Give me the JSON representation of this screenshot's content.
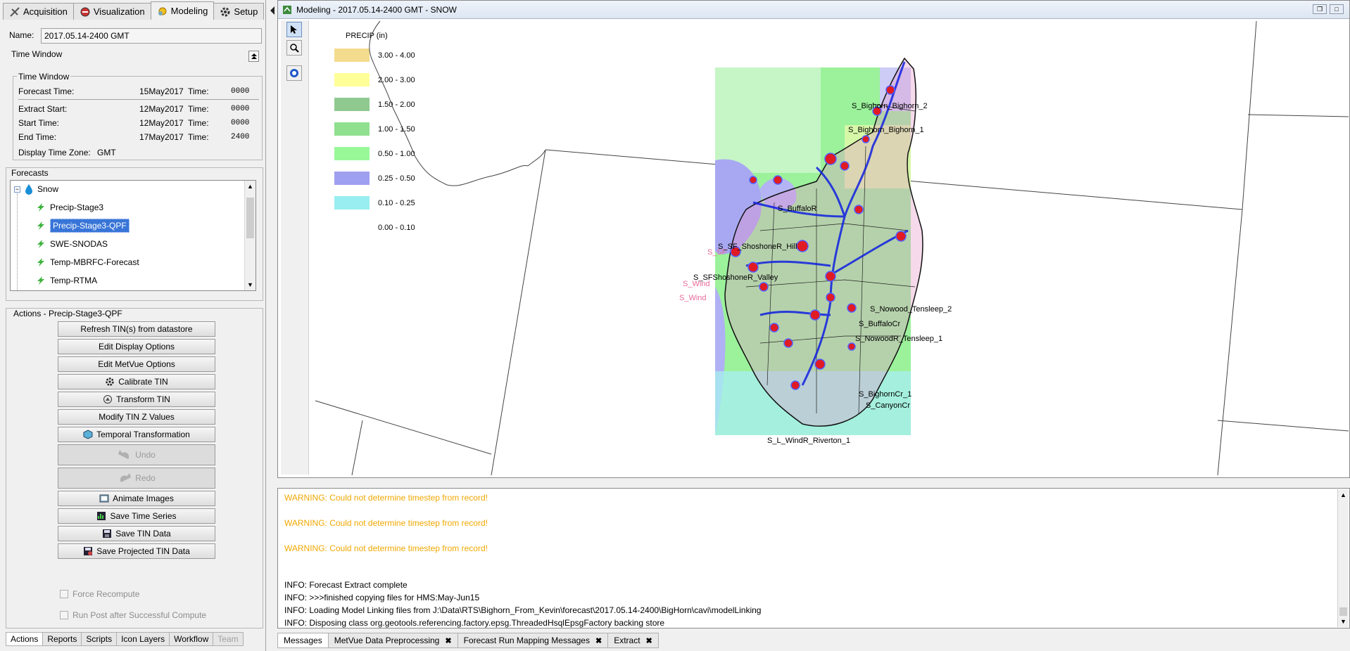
{
  "top_tabs": [
    {
      "label": "Acquisition",
      "icon": "acquisition-icon",
      "active": false
    },
    {
      "label": "Visualization",
      "icon": "visualization-icon",
      "active": false
    },
    {
      "label": "Modeling",
      "icon": "modeling-icon",
      "active": true
    },
    {
      "label": "Setup",
      "icon": "gear-icon",
      "active": false
    }
  ],
  "name": {
    "label": "Name:",
    "value": "2017.05.14-2400 GMT"
  },
  "time_window": {
    "section_label": "Time Window",
    "group_label": "Time Window",
    "forecast": {
      "label": "Forecast Time:",
      "date": "15May2017",
      "time_label": "Time:",
      "time": "0000"
    },
    "extract": {
      "label": "Extract Start:",
      "date": "12May2017",
      "time_label": "Time:",
      "time": "0000"
    },
    "start": {
      "label": "Start Time:",
      "date": "12May2017",
      "time_label": "Time:",
      "time": "0000"
    },
    "end": {
      "label": "End Time:",
      "date": "17May2017",
      "time_label": "Time:",
      "time": "2400"
    },
    "zone": {
      "label": "Display Time Zone:",
      "value": "GMT"
    }
  },
  "forecasts": {
    "label": "Forecasts",
    "root": "Snow",
    "items": [
      "Precip-Stage3",
      "Precip-Stage3-QPF",
      "SWE-SNODAS",
      "Temp-MBRFC-Forecast",
      "Temp-RTMA"
    ],
    "selected": "Precip-Stage3-QPF"
  },
  "actions": {
    "label": "Actions - Precip-Stage3-QPF",
    "buttons": [
      "Refresh TIN(s) from datastore",
      "Edit Display Options",
      "Edit MetVue Options",
      "Calibrate TIN",
      "Transform TIN",
      "Modify TIN Z Values",
      "Temporal Transformation",
      "Undo",
      "Redo",
      "Animate Images",
      "Save Time Series",
      "Save TIN Data",
      "Save Projected TIN Data"
    ],
    "checkboxes": [
      "Force Recompute",
      "Run Post after Successful Compute"
    ]
  },
  "bottom_tabs": [
    "Actions",
    "Reports",
    "Scripts",
    "Icon Layers",
    "Workflow",
    "Team"
  ],
  "map_window": {
    "title": "Modeling - 2017.05.14-2400 GMT - SNOW",
    "legend_title": "PRECIP (in)",
    "legend": [
      {
        "range": "3.00 - 4.00",
        "color": "#f3dc8e"
      },
      {
        "range": "2.00 - 3.00",
        "color": "#ffff99"
      },
      {
        "range": "1.50 - 2.00",
        "color": "#8fc98f"
      },
      {
        "range": "1.00 - 1.50",
        "color": "#90e090"
      },
      {
        "range": "0.50 - 1.00",
        "color": "#98f898"
      },
      {
        "range": "0.25 - 0.50",
        "color": "#9f9ff0"
      },
      {
        "range": "0.10 - 0.25",
        "color": "#98eef0"
      },
      {
        "range": "0.00 - 0.10",
        "color": "none"
      }
    ],
    "labels": [
      "S_Bighorn_Bighorn_2",
      "S_Bighorn_Bighorn_1",
      "S_SF_ShoshoneR_Hill",
      "S_SFShoshoneR_Valley",
      "S_Nowood_Tensleep_2",
      "S_NowoodR_Tensleep_1",
      "S_BuffaloCr",
      "S_BighornCr_1",
      "S_CanyonCr",
      "S_L_WindR_Riverton_1",
      "S_BuffaloR",
      "S_SF",
      "S_Wind",
      "S_Wind"
    ]
  },
  "log": {
    "lines": [
      {
        "text": "WARNING: Could not determine timestep from record!",
        "level": "warn"
      },
      {
        "text": "WARNING: Could not determine timestep from record!",
        "level": "warn"
      },
      {
        "text": "WARNING: Could not determine timestep from record!",
        "level": "warn"
      },
      {
        "text": "INFO: Forecast Extract complete",
        "level": "info"
      },
      {
        "text": "INFO: >>>finished copying files for HMS:May-Jun15",
        "level": "info"
      },
      {
        "text": "INFO: Loading Model Linking files from J:\\Data\\RTS\\Bighorn_From_Kevin\\forecast\\2017.05.14-2400\\BigHorn\\cavi\\modelLinking",
        "level": "info"
      },
      {
        "text": "INFO: Disposing class org.geotools.referencing.factory.epsg.ThreadedHsqlEpsgFactory backing store",
        "level": "info"
      }
    ]
  },
  "message_tabs": [
    {
      "label": "Messages",
      "closable": false
    },
    {
      "label": "MetVue Data Preprocessing",
      "closable": true
    },
    {
      "label": "Forecast Run Mapping Messages",
      "closable": true
    },
    {
      "label": "Extract",
      "closable": true
    }
  ],
  "colors": {
    "selection": "#3875d7",
    "warning": "#f0a800",
    "basin_marker": "#e01b24",
    "stream": "#1020e0"
  }
}
